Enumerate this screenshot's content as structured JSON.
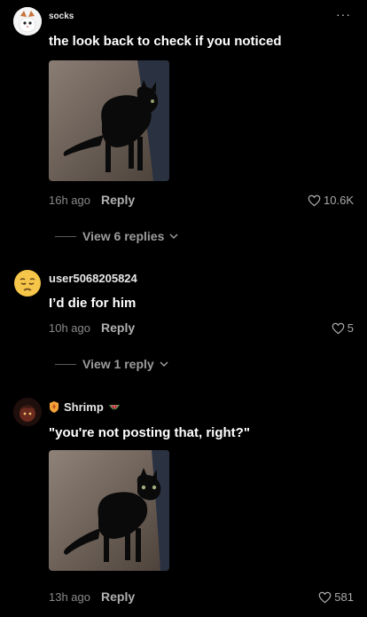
{
  "comments": [
    {
      "username": "socks",
      "text": "the look back to check if you noticed",
      "time": "16h ago",
      "reply_label": "Reply",
      "likes": "10.6K",
      "view_replies": "View 6 replies",
      "more_icon": "more-icon"
    },
    {
      "username": "user5068205824",
      "text": "I’d die for him",
      "time": "10h ago",
      "reply_label": "Reply",
      "likes": "5",
      "view_replies": "View 1 reply"
    },
    {
      "username": "Shrimp",
      "text": "\"you're not posting that, right?\"",
      "time": "13h ago",
      "reply_label": "Reply",
      "likes": "581"
    }
  ],
  "colors": {
    "background": "#000000",
    "muted": "#8a8a8a"
  }
}
